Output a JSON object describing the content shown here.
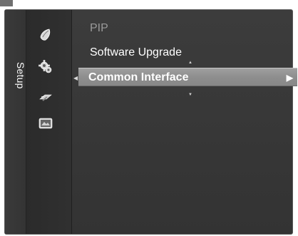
{
  "sidebar": {
    "title": "Setup",
    "icons": [
      "picture-icon",
      "setup-gear-icon",
      "input-icon",
      "application-icon"
    ]
  },
  "menu": {
    "items": [
      {
        "label": "PIP",
        "state": "disabled"
      },
      {
        "label": "Software Upgrade",
        "state": "normal"
      },
      {
        "label": "Common Interface",
        "state": "selected"
      }
    ],
    "submenu_arrow": "▶"
  },
  "colors": {
    "panel": "#383838",
    "selected": "#959595",
    "text": "#ffffff",
    "disabled_text": "#9a9a9a"
  }
}
